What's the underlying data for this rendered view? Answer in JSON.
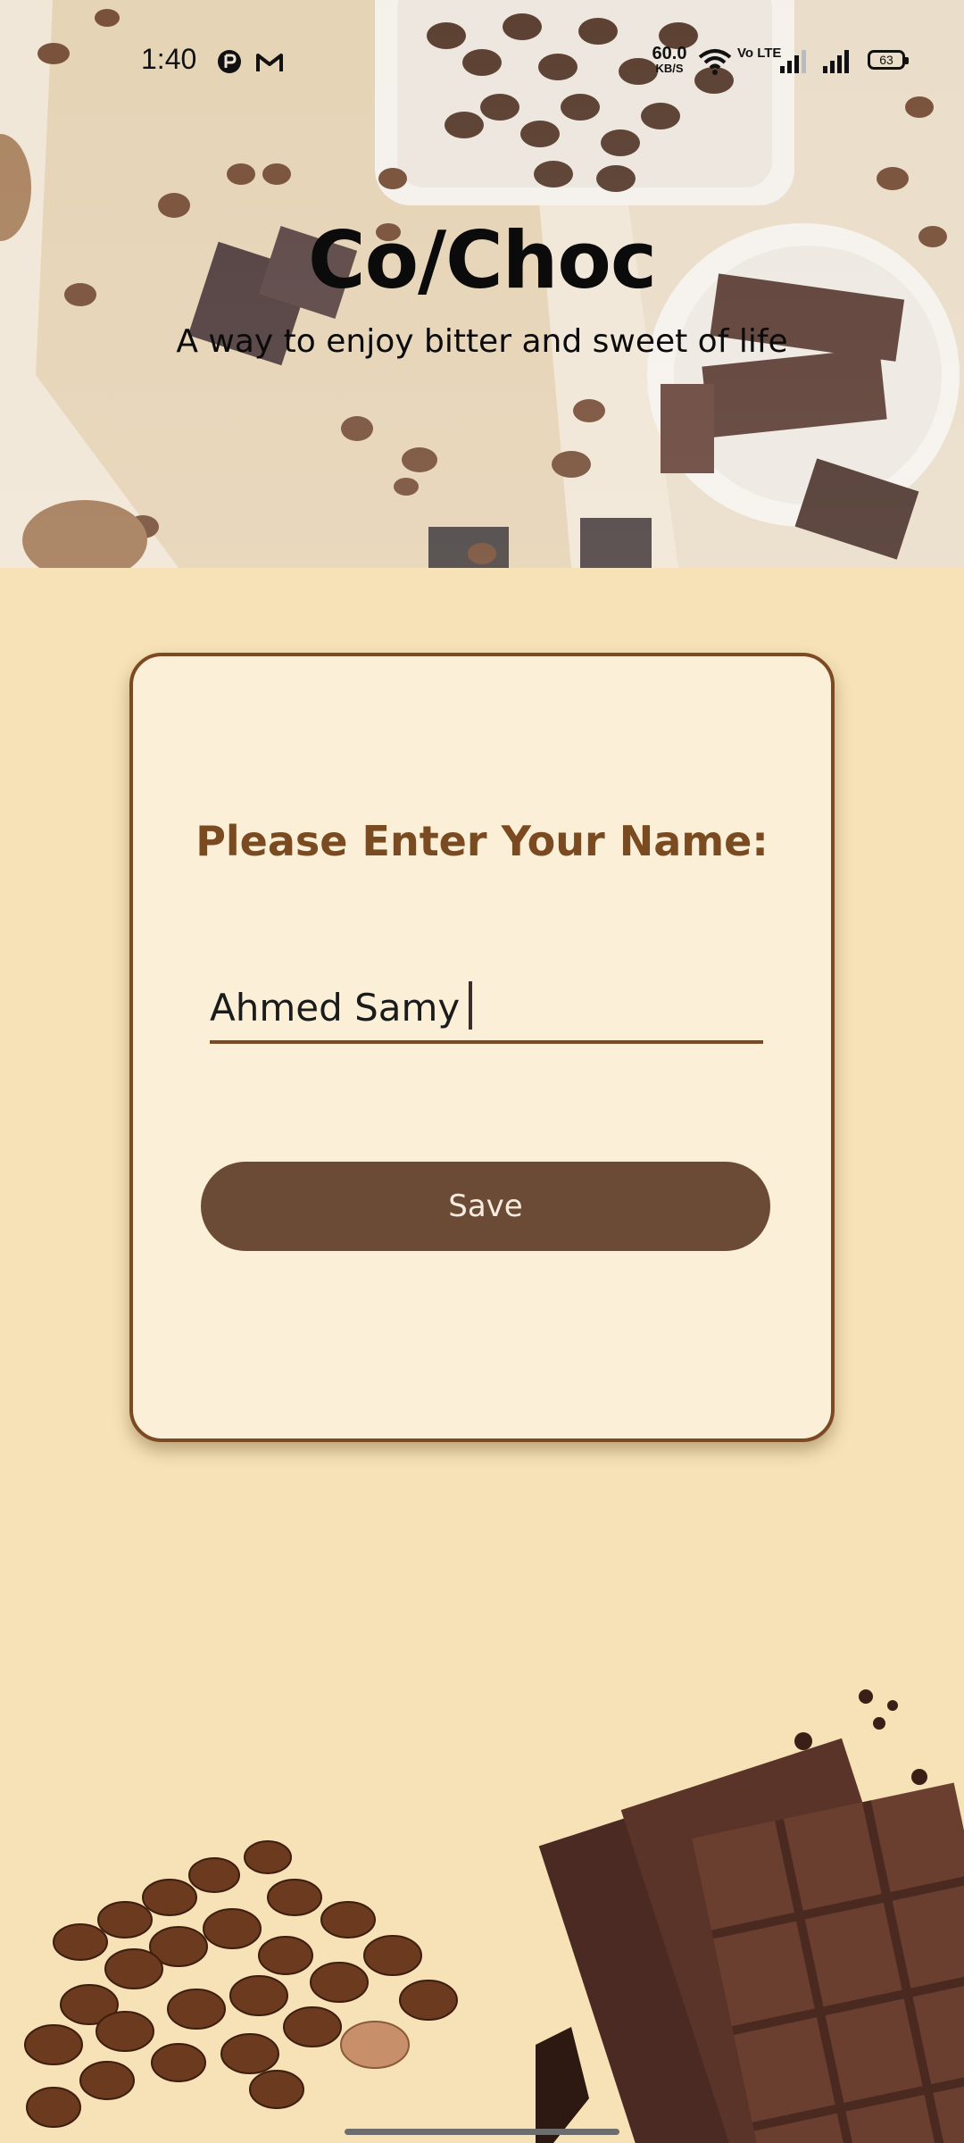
{
  "status_bar": {
    "time": "1:40",
    "net_speed_value": "60.0",
    "net_speed_unit": "KB/S",
    "volte": "Vo LTE",
    "battery": "63",
    "icons": [
      "pinterest-style-icon",
      "gmail-icon",
      "wifi-icon",
      "signal-icon",
      "signal-icon-2",
      "battery-icon"
    ]
  },
  "hero": {
    "title": "Co/Choc",
    "tagline": "A way to enjoy bitter and sweet of life"
  },
  "form": {
    "prompt": "Please Enter Your Name:",
    "name_value": "Ahmed Samy",
    "save_label": "Save"
  },
  "colors": {
    "background": "#f6e2b6",
    "card_bg": "#fbefd7",
    "card_border": "#7b4a22",
    "accent_text": "#7a4a21",
    "button": "#6b4b36"
  }
}
